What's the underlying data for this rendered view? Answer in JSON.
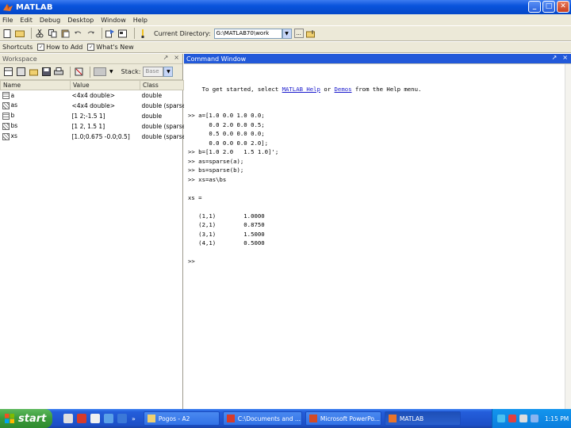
{
  "window": {
    "title": "MATLAB",
    "minimize": "_",
    "maximize": "□",
    "close": "✕"
  },
  "menu": [
    "File",
    "Edit",
    "Debug",
    "Desktop",
    "Window",
    "Help"
  ],
  "toolbar": {
    "current_directory_label": "Current Directory:",
    "current_directory_value": "G:\\MATLAB70\\work",
    "browse_label": "..."
  },
  "shortcuts": {
    "shortcuts_label": "Shortcuts",
    "items": [
      "How to Add",
      "What's New"
    ]
  },
  "workspace": {
    "title": "Workspace",
    "stack_label": "Stack:",
    "stack_value": "Base",
    "columns": [
      "Name",
      "Value",
      "Class"
    ],
    "rows": [
      {
        "name": "a",
        "value": "<4x4 double>",
        "class": "double",
        "sparse": false
      },
      {
        "name": "as",
        "value": "<4x4 double>",
        "class": "double (sparse)",
        "sparse": true
      },
      {
        "name": "b",
        "value": "[1 2;-1.5 1]",
        "class": "double",
        "sparse": false
      },
      {
        "name": "bs",
        "value": "[1 2, 1.5 1]",
        "class": "double (sparse)",
        "sparse": true
      },
      {
        "name": "xs",
        "value": "[1.0;0.675 -0.0;0.5]",
        "class": "double (sparse)",
        "sparse": true
      }
    ]
  },
  "command_window": {
    "title": "Command Window",
    "intro_prefix": "To get started, select ",
    "link_help": "MATLAB Help",
    "intro_middle": " or ",
    "link_demos": "Demos",
    "intro_suffix": " from the Help menu.",
    "lines": [
      ">> a=[1.0 0.0 1.0 0.0;",
      "      0.0 2.0 0.0 0.5;",
      "      0.5 0.0 0.0 0.0;",
      "      0.0 0.0 0.0 2.0];",
      ">> b=[1.0 2.0   1.5 1.0]';",
      ">> as=sparse(a);",
      ">> bs=sparse(b);",
      ">> xs=as\\bs",
      "",
      "xs =",
      "",
      "   (1,1)        1.0000",
      "   (2,1)        0.8750",
      "   (3,1)        1.5000",
      "   (4,1)        0.5000",
      "",
      ">>"
    ]
  },
  "taskbar": {
    "start": "start",
    "tasks": [
      "Pogos - A2",
      "C:\\Documents and ...",
      "Microsoft PowerPo...",
      "MATLAB"
    ],
    "clock": "1:15 PM"
  }
}
